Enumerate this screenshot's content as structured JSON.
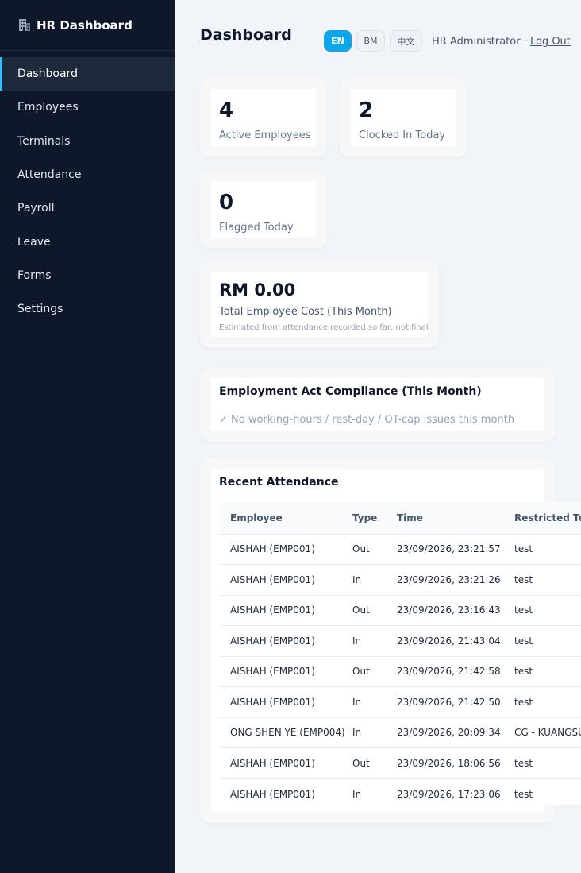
{
  "sidebar": {
    "brand": "HR Dashboard",
    "brand_icon": "building-icon",
    "items": [
      {
        "label": "Dashboard",
        "active": true
      },
      {
        "label": "Employees"
      },
      {
        "label": "Terminals"
      },
      {
        "label": "Attendance"
      },
      {
        "label": "Payroll"
      },
      {
        "label": "Leave"
      },
      {
        "label": "Forms"
      },
      {
        "label": "Settings"
      }
    ]
  },
  "header": {
    "title": "Dashboard",
    "languages": [
      "EN",
      "BM",
      "中文"
    ],
    "active_language": "EN",
    "user": "HR Administrator ·",
    "logout": "Log Out"
  },
  "stats": {
    "active_employees": {
      "value": "4",
      "label": "Active Employees"
    },
    "clocked_in": {
      "value": "2",
      "label": "Clocked In Today"
    },
    "flagged": {
      "value": "0",
      "label": "Flagged Today"
    },
    "cost": {
      "value": "RM 0.00",
      "label": "Total Employee Cost (This Month)",
      "note": "Estimated from attendance recorded so far, not final"
    }
  },
  "compliance": {
    "title": "Employment Act Compliance (This Month)",
    "status": "✓ No working-hours / rest-day / OT-cap issues this month"
  },
  "attendance": {
    "title": "Recent Attendance",
    "columns": [
      "Employee",
      "Type",
      "Time",
      "Restricted Terminal"
    ],
    "rows": [
      [
        "AISHAH (EMP001)",
        "Out",
        "23/09/2026, 23:21:57",
        "test"
      ],
      [
        "AISHAH (EMP001)",
        "In",
        "23/09/2026, 23:21:26",
        "test"
      ],
      [
        "AISHAH (EMP001)",
        "Out",
        "23/09/2026, 23:16:43",
        "test"
      ],
      [
        "AISHAH (EMP001)",
        "In",
        "23/09/2026, 21:43:04",
        "test"
      ],
      [
        "AISHAH (EMP001)",
        "Out",
        "23/09/2026, 21:42:58",
        "test"
      ],
      [
        "AISHAH (EMP001)",
        "In",
        "23/09/2026, 21:42:50",
        "test"
      ],
      [
        "ONG SHEN YE (EMP004)",
        "In",
        "23/09/2026, 20:09:34",
        "CG - KUANGSU"
      ],
      [
        "AISHAH (EMP001)",
        "Out",
        "23/09/2026, 18:06:56",
        "test"
      ],
      [
        "AISHAH (EMP001)",
        "In",
        "23/09/2026, 17:23:06",
        "test"
      ]
    ]
  },
  "colors": {
    "sidebar_bg": "#0f172a",
    "accent": "#0ea5e9",
    "active_border": "#38bdf8",
    "page_bg": "#f1f4f9"
  }
}
